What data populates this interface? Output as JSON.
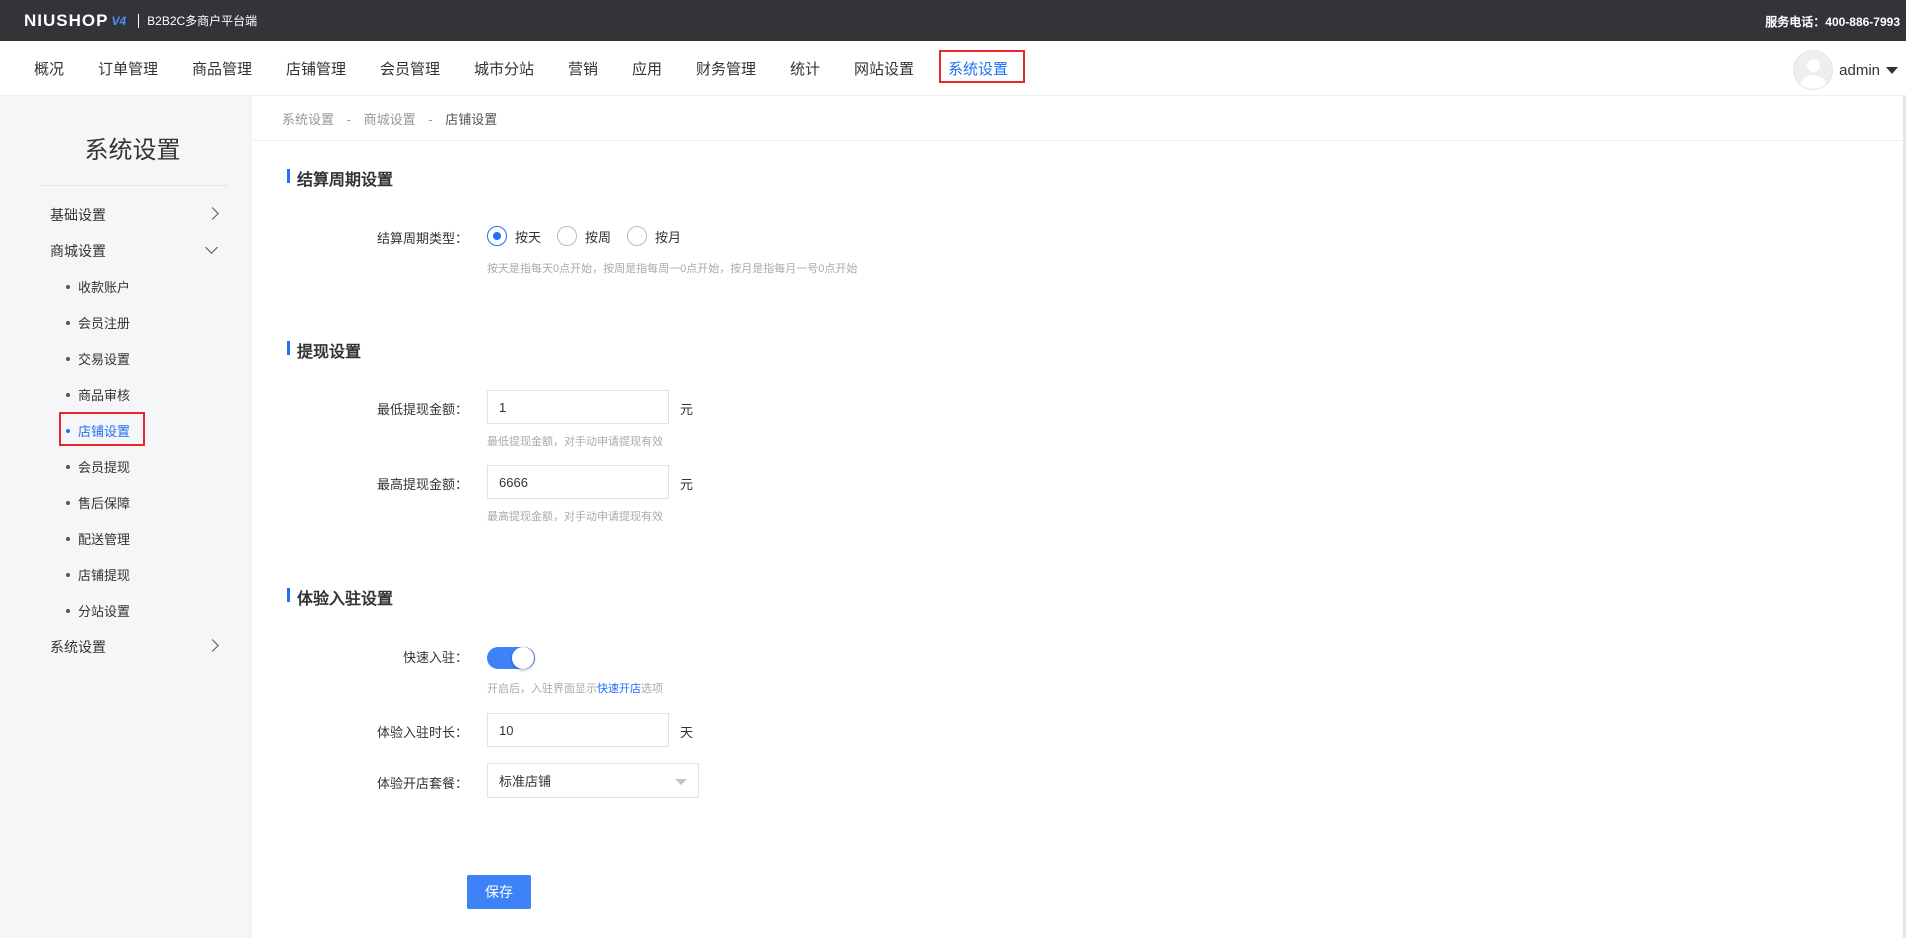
{
  "topbar": {
    "logo_text": "NIUSHOP",
    "logo_version": "V4",
    "platform": "B2B2C多商户平台端",
    "hotline": "服务电话：400-886-7993"
  },
  "nav": {
    "items": [
      "概况",
      "订单管理",
      "商品管理",
      "店铺管理",
      "会员管理",
      "城市分站",
      "营销",
      "应用",
      "财务管理",
      "统计",
      "网站设置",
      "系统设置"
    ],
    "active": "系统设置",
    "username": "admin"
  },
  "sidebar": {
    "title": "系统设置",
    "groups": [
      {
        "label": "基础设置"
      },
      {
        "label": "商城设置",
        "children": [
          "收款账户",
          "会员注册",
          "交易设置",
          "商品审核",
          "店铺设置",
          "会员提现",
          "售后保障",
          "配送管理",
          "店铺提现",
          "分站设置"
        ]
      },
      {
        "label": "系统设置"
      }
    ],
    "active_item": "店铺设置"
  },
  "breadcrumb": [
    "系统设置",
    "商城设置",
    "店铺设置"
  ],
  "breadcrumb_sep": "-",
  "settlement": {
    "title": "结算周期设置",
    "type_label": "结算周期类型：",
    "options": [
      "按天",
      "按周",
      "按月"
    ],
    "selected": "按天",
    "hint": "按天是指每天0点开始，按周是指每周一0点开始，按月是指每月一号0点开始"
  },
  "withdraw": {
    "title": "提现设置",
    "min_label": "最低提现金额：",
    "min_value": "1",
    "min_unit": "元",
    "min_hint": "最低提现金额，对手动申请提现有效",
    "max_label": "最高提现金额：",
    "max_value": "6666",
    "max_unit": "元",
    "max_hint": "最高提现金额，对手动申请提现有效"
  },
  "trial": {
    "title": "体验入驻设置",
    "quick_label": "快速入驻：",
    "quick_enabled": true,
    "quick_hint_pre": "开启后，入驻界面显示",
    "quick_hint_link": "快速开店",
    "quick_hint_post": "选项",
    "duration_label": "体验入驻时长：",
    "duration_value": "10",
    "duration_unit": "天",
    "package_label": "体验开店套餐：",
    "package_value": "标准店铺"
  },
  "save_label": "保存",
  "colors": {
    "accent": "#1f6ff7",
    "topbar": "#333438",
    "highlight_box": "#e8262b"
  }
}
